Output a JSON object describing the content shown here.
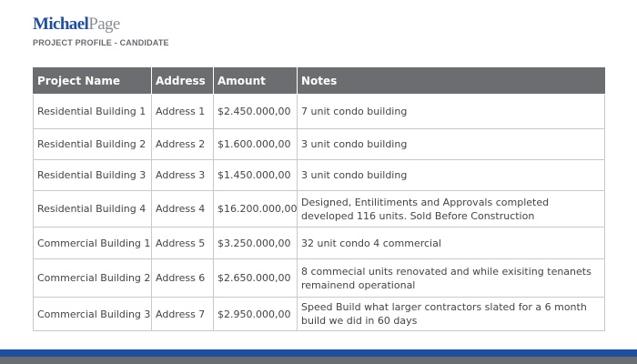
{
  "logo": {
    "part1": "Michael",
    "part2": "Page"
  },
  "subtitle": "PROJECT PROFILE - CANDIDATE",
  "table": {
    "headers": [
      "Project Name",
      "Address",
      "Amount",
      "Notes"
    ],
    "rows": [
      [
        "Residential Building 1",
        "Address 1",
        "$2.450.000,00",
        "7 unit condo building"
      ],
      [
        "Residential Building 2",
        "Address 2",
        "$1.600.000,00",
        "3 unit condo building"
      ],
      [
        "Residential Building 3",
        "Address 3",
        "$1.450.000,00",
        "3 unit condo building"
      ],
      [
        "Residential Building 4",
        "Address 4",
        "$16.200.000,00",
        "Designed, Entilitiments and Approvals completed developed 116 units. Sold Before Construction"
      ],
      [
        "Commercial Building 1",
        "Address 5",
        "$3.250.000,00",
        "32 unit condo 4 commercial"
      ],
      [
        "Commercial Building 2",
        "Address 6",
        "$2.650.000,00",
        "8 commecial units renovated and while exisiting tenanets remainend operational"
      ],
      [
        "Commercial Building 3",
        "Address 7",
        "$2.950.000,00",
        "Speed Build what larger contractors slated for a 6 month build we did in 60 days"
      ]
    ]
  },
  "colors": {
    "brand_blue": "#1f4e9c",
    "header_gray": "#6c6d70"
  }
}
